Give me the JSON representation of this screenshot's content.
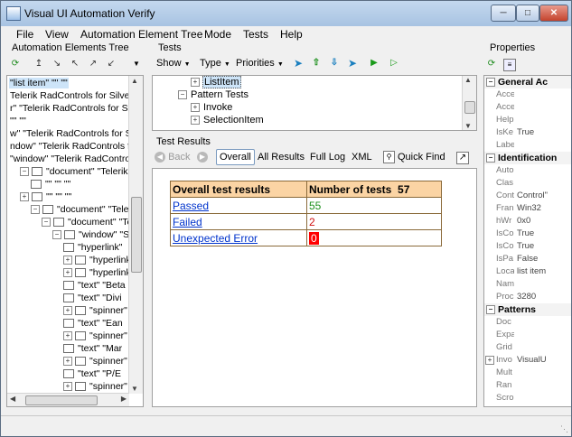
{
  "window": {
    "title": "Visual UI Automation Verify"
  },
  "menu": [
    "File",
    "View",
    "Automation Element Tree",
    "Mode",
    "Tests",
    "Help"
  ],
  "tree_pane": {
    "title": "Automation Elements Tree",
    "nodes": [
      {
        "text": "\"list item\" \"\" \"\"",
        "indent": 0,
        "exp": "",
        "box": false,
        "selected": true
      },
      {
        "text": "Telerik RadControls for Silverlight",
        "indent": 0,
        "exp": "",
        "box": false
      },
      {
        "text": "r\" \"Telerik RadControls for Silve",
        "indent": 0,
        "exp": "",
        "box": false
      },
      {
        "text": "\"\" \"\"",
        "indent": 0,
        "exp": "",
        "box": false
      },
      {
        "text": "w\" \"Telerik RadControls for Silve",
        "indent": 0,
        "exp": "",
        "box": false
      },
      {
        "text": "ndow\" \"Telerik RadControls for S",
        "indent": 0,
        "exp": "",
        "box": false
      },
      {
        "text": "\"window\" \"Telerik RadControls",
        "indent": 0,
        "exp": "",
        "box": false
      },
      {
        "text": "\"document\" \"Telerik RadCo",
        "indent": 1,
        "exp": "minus",
        "box": true
      },
      {
        "text": "\"\" \"\" \"\"",
        "indent": 2,
        "exp": "",
        "box": true
      },
      {
        "text": "\"\" \"\" \"\"",
        "indent": 1,
        "exp": "plus",
        "box": true
      },
      {
        "text": "\"document\" \"Telerik Ra",
        "indent": 2,
        "exp": "minus",
        "box": true
      },
      {
        "text": "\"document\" \"Teleri",
        "indent": 3,
        "exp": "minus",
        "box": true
      },
      {
        "text": "\"window\" \"Silve",
        "indent": 4,
        "exp": "minus",
        "box": true
      },
      {
        "text": "\"hyperlink\"",
        "indent": 5,
        "exp": "",
        "box": true
      },
      {
        "text": "\"hyperlink\"",
        "indent": 5,
        "exp": "plus",
        "box": true
      },
      {
        "text": "\"hyperlink\"",
        "indent": 5,
        "exp": "plus",
        "box": true
      },
      {
        "text": "\"text\" \"Beta",
        "indent": 5,
        "exp": "",
        "box": true
      },
      {
        "text": "\"text\" \"Divi",
        "indent": 5,
        "exp": "",
        "box": true
      },
      {
        "text": "\"spinner\" \"",
        "indent": 5,
        "exp": "plus",
        "box": true
      },
      {
        "text": "\"text\" \"Ean",
        "indent": 5,
        "exp": "",
        "box": true
      },
      {
        "text": "\"spinner\" \"",
        "indent": 5,
        "exp": "plus",
        "box": true
      },
      {
        "text": "\"text\" \"Mar",
        "indent": 5,
        "exp": "",
        "box": true
      },
      {
        "text": "\"spinner\" \"",
        "indent": 5,
        "exp": "plus",
        "box": true
      },
      {
        "text": "\"text\" \"P/E",
        "indent": 5,
        "exp": "",
        "box": true
      },
      {
        "text": "\"spinner\" \"",
        "indent": 5,
        "exp": "plus",
        "box": true
      }
    ]
  },
  "tests_pane": {
    "title": "Tests",
    "toolbar": {
      "show": "Show",
      "type": "Type",
      "priorities": "Priorities"
    },
    "nodes": [
      {
        "text": "ListItem",
        "indent": 2,
        "exp": "plus",
        "selected": true
      },
      {
        "text": "Pattern Tests",
        "indent": 1,
        "exp": "minus",
        "selected": false
      },
      {
        "text": "Invoke",
        "indent": 2,
        "exp": "plus",
        "selected": false
      },
      {
        "text": "SelectionItem",
        "indent": 2,
        "exp": "plus",
        "selected": false
      }
    ]
  },
  "results_pane": {
    "title": "Test Results",
    "toolbar": {
      "back": "Back",
      "overall": "Overall",
      "all": "All Results",
      "full_log": "Full Log",
      "xml": "XML",
      "quick_find": "Quick Find"
    },
    "table": {
      "header_left": "Overall test results",
      "header_right": "Number of tests",
      "total": "57",
      "rows": [
        {
          "label": "Passed",
          "value": "55",
          "color": "#1a8f1a"
        },
        {
          "label": "Failed",
          "value": "2",
          "color": "#d01010"
        },
        {
          "label": "Unexpected Error",
          "value": "0",
          "color": "#ffffff",
          "bg": "#ff0000"
        }
      ]
    }
  },
  "props_pane": {
    "title": "Properties",
    "categories": [
      {
        "name": "General Ac",
        "rows": [
          {
            "n": "Acce",
            "v": ""
          },
          {
            "n": "Acce",
            "v": ""
          },
          {
            "n": "Help",
            "v": ""
          },
          {
            "n": "IsKe",
            "v": "True"
          },
          {
            "n": "Labe",
            "v": ""
          }
        ]
      },
      {
        "name": "Identification",
        "rows": [
          {
            "n": "Auto",
            "v": ""
          },
          {
            "n": "Clas",
            "v": ""
          },
          {
            "n": "Cont",
            "v": "Control\""
          },
          {
            "n": "Fran",
            "v": "Win32"
          },
          {
            "n": "hWr",
            "v": "0x0"
          },
          {
            "n": "IsCo",
            "v": "True"
          },
          {
            "n": "IsCo",
            "v": "True"
          },
          {
            "n": "IsPa",
            "v": "False"
          },
          {
            "n": "Loca",
            "v": "list item"
          },
          {
            "n": "Nam",
            "v": ""
          },
          {
            "n": "Proc",
            "v": "3280"
          }
        ]
      },
      {
        "name": "Patterns",
        "rows": [
          {
            "n": "Doc",
            "v": ""
          },
          {
            "n": "Expa",
            "v": ""
          },
          {
            "n": "Grid",
            "v": ""
          },
          {
            "n": "Invo",
            "v": "VisualU",
            "exp": "plus"
          },
          {
            "n": "Mult",
            "v": ""
          },
          {
            "n": "Ran",
            "v": ""
          },
          {
            "n": "Scro",
            "v": ""
          }
        ]
      }
    ]
  }
}
